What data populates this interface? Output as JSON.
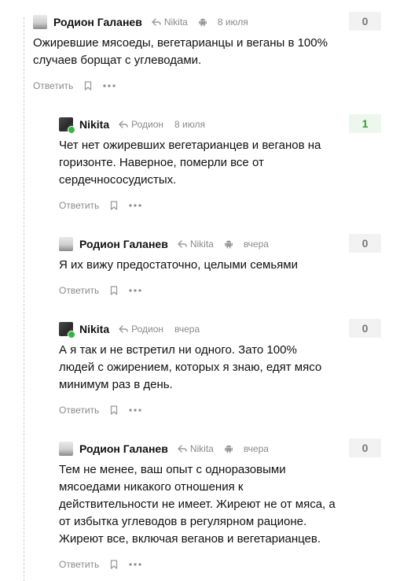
{
  "labels": {
    "reply": "Ответить"
  },
  "icons": {
    "reply_arrow": "reply-arrow-icon",
    "device": "android-icon",
    "bookmark": "bookmark-icon",
    "more": "more-horizontal-icon"
  },
  "colors": {
    "online": "#32b742",
    "positive_rating": "#2e9e2e",
    "muted": "#8a8a8a"
  },
  "comments": [
    {
      "author": "Родион Галанев",
      "reply_to": "Nikita",
      "date": "8 июля",
      "rating": "0",
      "text": "Ожиревшие мясоеды, вегетарианцы и веганы в 100% случаев борщат с углеводами."
    },
    {
      "author": "Nikita",
      "reply_to": "Родион",
      "date": "8 июля",
      "rating": "1",
      "text": "Чет нет ожиревших вегетарианцев и веганов на горизонте. Наверное, померли все от сердечнососудистых."
    },
    {
      "author": "Родион Галанев",
      "reply_to": "Nikita",
      "date": "вчера",
      "rating": "0",
      "text": "Я их вижу предостаточно, целыми семьями"
    },
    {
      "author": "Nikita",
      "reply_to": "Родион",
      "date": "вчера",
      "rating": "0",
      "text": "А я так и не встретил ни одного. Зато 100% людей с ожирением, которых я знаю, едят мясо минимум раз в день."
    },
    {
      "author": "Родион Галанев",
      "reply_to": "Nikita",
      "date": "вчера",
      "rating": "0",
      "text": "Тем не менее, ваш опыт с одноразовыми мясоедами никакого отношения к действительности не имеет. Жиреют не от мяса, а от избытка углеводов в регулярном рационе. Жиреют все, включая веганов и вегетарианцев."
    }
  ]
}
